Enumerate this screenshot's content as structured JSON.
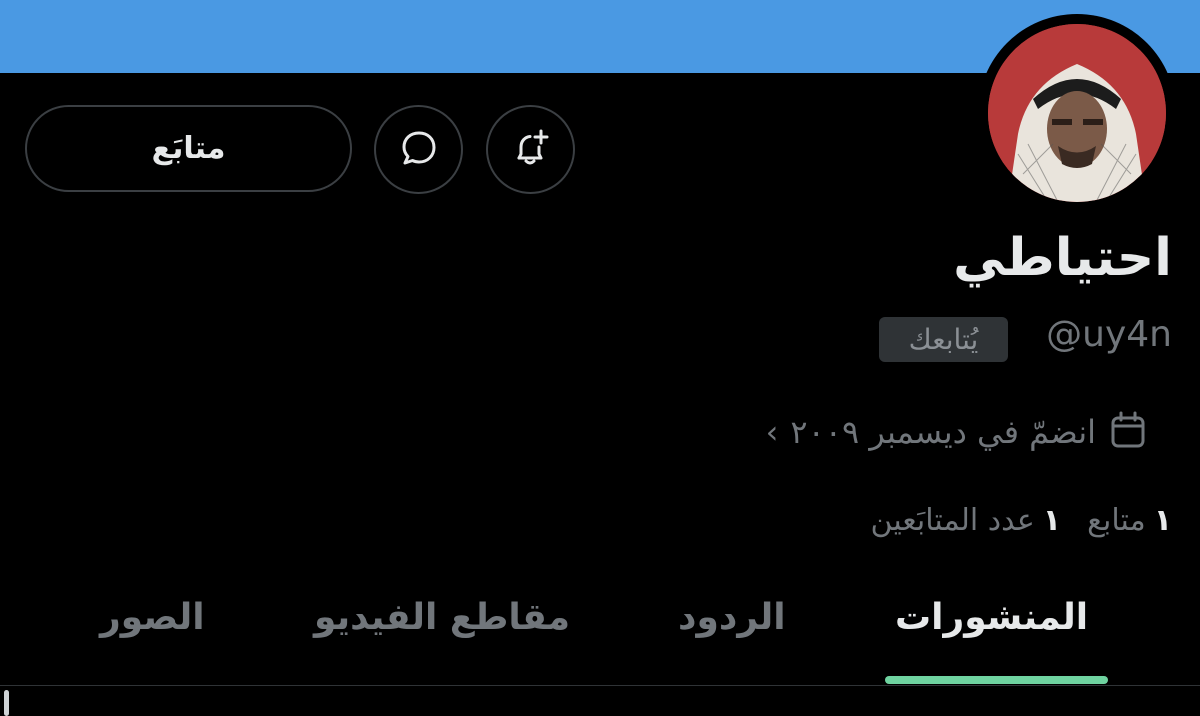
{
  "profile": {
    "display_name": "احتياطي",
    "handle": "@uy4n",
    "follows_you_badge": "يُتابعك",
    "joined": "انضمّ في ديسمبر ٢٠٠٩",
    "avatar": "profile-avatar"
  },
  "actions": {
    "follow_label": "متابَع",
    "message_icon": "message-bubble-icon",
    "notify_icon": "bell-plus-icon"
  },
  "stats": {
    "following_count": "١",
    "following_label": "عدد المتابَعين",
    "followers_count": "١",
    "followers_label": "متابع"
  },
  "tabs": [
    {
      "label": "المنشورات",
      "active": true
    },
    {
      "label": "الردود",
      "active": false
    },
    {
      "label": "مقاطع الفيديو",
      "active": false
    },
    {
      "label": "الصور",
      "active": false
    }
  ],
  "colors": {
    "banner": "#4a99e3",
    "background": "#000000",
    "tab_indicator": "#6fd3a0",
    "muted_text": "#71767b"
  }
}
